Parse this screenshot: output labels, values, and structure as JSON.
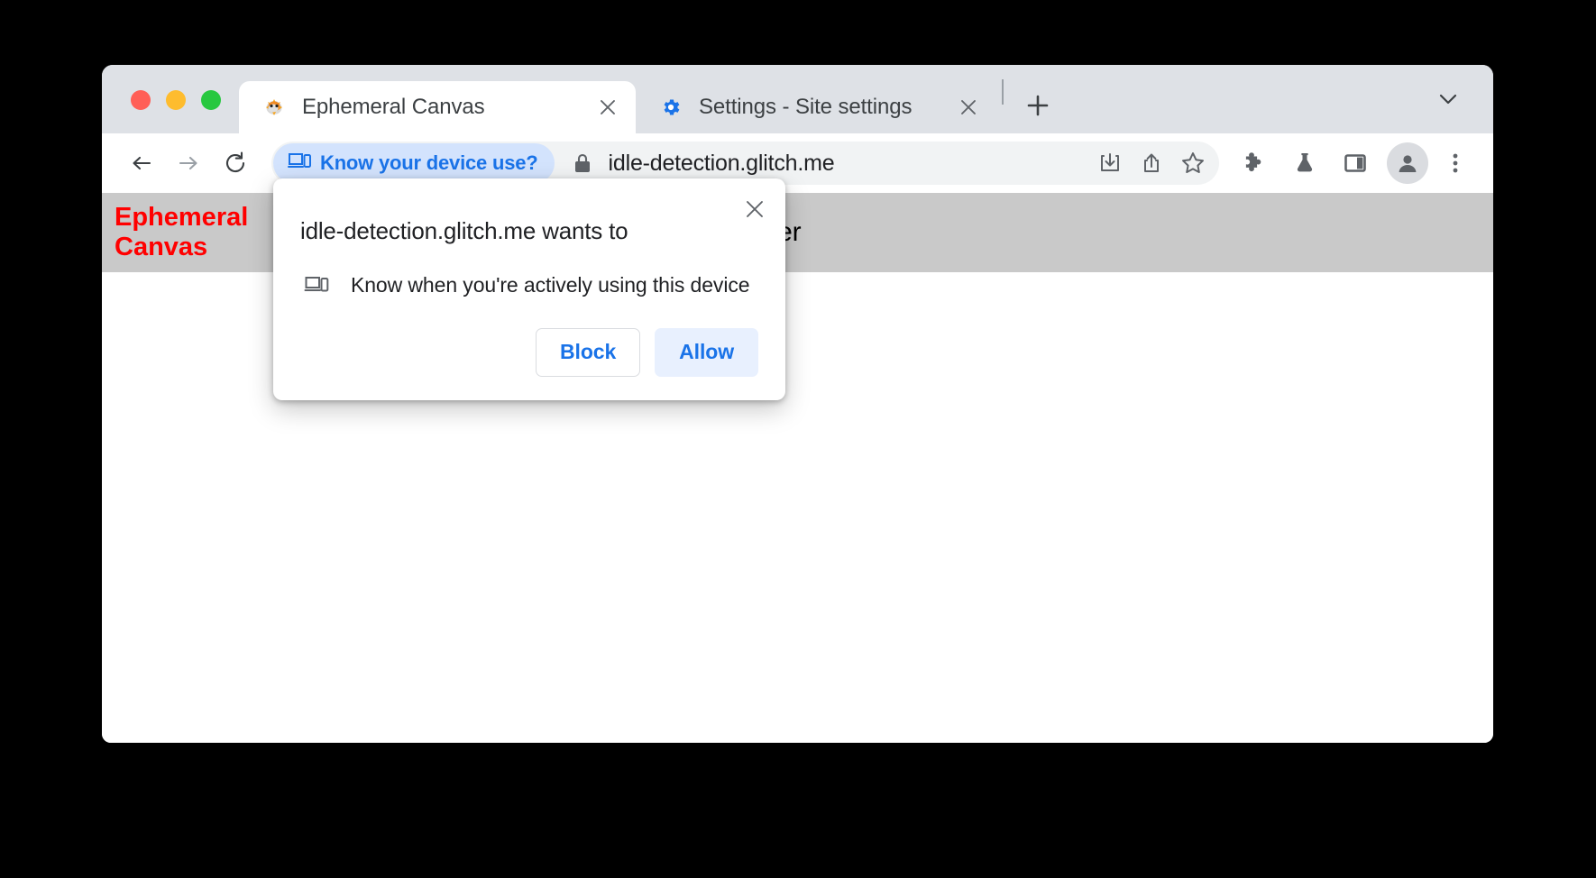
{
  "window": {
    "traffic_lights": [
      "close",
      "minimize",
      "maximize"
    ]
  },
  "tabstrip": {
    "tabs": [
      {
        "title": "Ephemeral Canvas",
        "favicon": "blowfish-icon",
        "active": true
      },
      {
        "title": "Settings - Site settings",
        "favicon": "gear-icon",
        "active": false
      }
    ],
    "new_tab_label": "+",
    "tab_search_label": "v"
  },
  "toolbar": {
    "back_label": "Back",
    "forward_label": "Forward",
    "reload_label": "Reload",
    "chip": {
      "label": "Know your device use?",
      "icon": "device-idle-icon",
      "text_color": "#1a73e8",
      "background": "#d3e3fd"
    },
    "omnibox": {
      "security_icon": "lock-icon",
      "url": "idle-detection.glitch.me"
    },
    "omnibox_actions": [
      "install-icon",
      "share-icon",
      "bookmark-star-icon"
    ],
    "actions": [
      "extensions-puzzle-icon",
      "experiments-flask-icon",
      "side-panel-icon"
    ],
    "profile_label": "Profile",
    "menu_label": "Customize and control"
  },
  "page": {
    "title": "Ephemeral Canvas",
    "note": "Don't move your mouse during 60s after",
    "title_color": "#ff0000",
    "header_background": "#c9c9c9"
  },
  "dialog": {
    "title": "idle-detection.glitch.me wants to",
    "permission_icon": "device-idle-icon",
    "permission_text": "Know when you're actively using this device",
    "close_label": "Close",
    "buttons": {
      "block": "Block",
      "allow": "Allow"
    },
    "accent_color": "#1a73e8"
  }
}
